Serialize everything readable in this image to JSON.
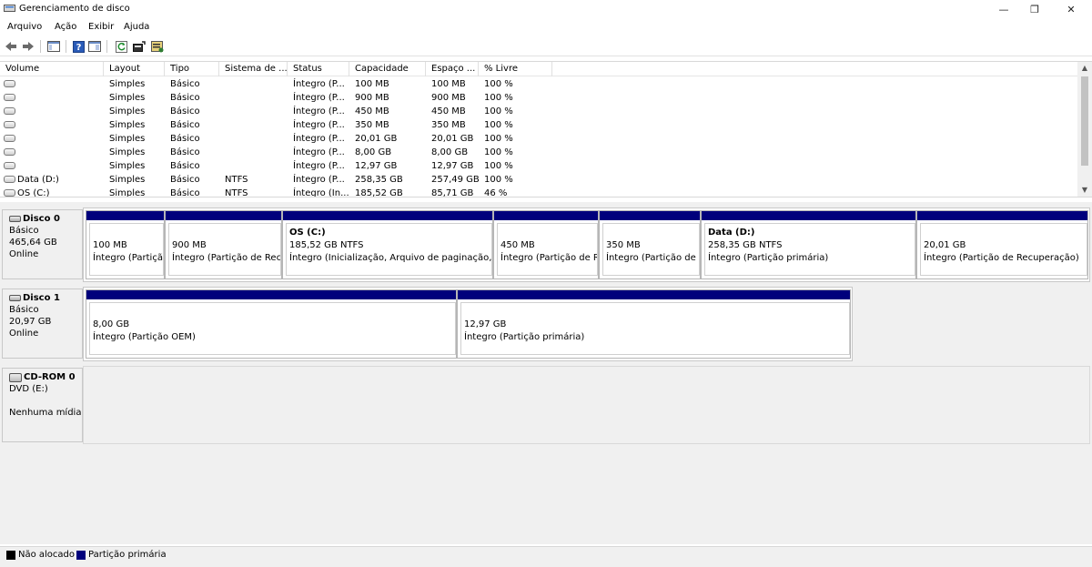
{
  "window": {
    "title": "Gerenciamento de disco",
    "minimize": "—",
    "maximize": "❐",
    "close": "✕"
  },
  "menu": [
    "Arquivo",
    "Ação",
    "Exibir",
    "Ajuda"
  ],
  "list": {
    "columns": [
      "Volume",
      "Layout",
      "Tipo",
      "Sistema de ...",
      "Status",
      "Capacidade",
      "Espaço ...",
      "% Livre"
    ],
    "rows": [
      {
        "volume": "",
        "layout": "Simples",
        "tipo": "Básico",
        "fs": "",
        "status": "Íntegro (P...",
        "cap": "100 MB",
        "free": "100 MB",
        "pct": "100 %"
      },
      {
        "volume": "",
        "layout": "Simples",
        "tipo": "Básico",
        "fs": "",
        "status": "Íntegro (P...",
        "cap": "900 MB",
        "free": "900 MB",
        "pct": "100 %"
      },
      {
        "volume": "",
        "layout": "Simples",
        "tipo": "Básico",
        "fs": "",
        "status": "Íntegro (P...",
        "cap": "450 MB",
        "free": "450 MB",
        "pct": "100 %"
      },
      {
        "volume": "",
        "layout": "Simples",
        "tipo": "Básico",
        "fs": "",
        "status": "Íntegro (P...",
        "cap": "350 MB",
        "free": "350 MB",
        "pct": "100 %"
      },
      {
        "volume": "",
        "layout": "Simples",
        "tipo": "Básico",
        "fs": "",
        "status": "Íntegro (P...",
        "cap": "20,01 GB",
        "free": "20,01 GB",
        "pct": "100 %"
      },
      {
        "volume": "",
        "layout": "Simples",
        "tipo": "Básico",
        "fs": "",
        "status": "Íntegro (P...",
        "cap": "8,00 GB",
        "free": "8,00 GB",
        "pct": "100 %"
      },
      {
        "volume": "",
        "layout": "Simples",
        "tipo": "Básico",
        "fs": "",
        "status": "Íntegro (P...",
        "cap": "12,97 GB",
        "free": "12,97 GB",
        "pct": "100 %"
      },
      {
        "volume": "Data (D:)",
        "layout": "Simples",
        "tipo": "Básico",
        "fs": "NTFS",
        "status": "Íntegro (P...",
        "cap": "258,35 GB",
        "free": "257,49 GB",
        "pct": "100 %"
      },
      {
        "volume": "OS (C:)",
        "layout": "Simples",
        "tipo": "Básico",
        "fs": "NTFS",
        "status": "Íntegro (In...",
        "cap": "185,52 GB",
        "free": "85,71 GB",
        "pct": "46 %"
      }
    ]
  },
  "disks": [
    {
      "name": "Disco 0",
      "type": "Básico",
      "size": "465,64 GB",
      "state": "Online",
      "partitions": [
        {
          "name": "",
          "size": "100 MB",
          "status": "Íntegro (Partição do Sistema EFI)"
        },
        {
          "name": "",
          "size": "900 MB",
          "status": "Íntegro (Partição de Recuperação)"
        },
        {
          "name": "OS  (C:)",
          "size": "185,52 GB NTFS",
          "status": "Íntegro (Inicialização, Arquivo de paginação, Despejo de Memória, Partição primária)"
        },
        {
          "name": "",
          "size": "450 MB",
          "status": "Íntegro (Partição de Recuperação)"
        },
        {
          "name": "",
          "size": "350 MB",
          "status": "Íntegro (Partição de Recuperação)"
        },
        {
          "name": "Data  (D:)",
          "size": "258,35 GB NTFS",
          "status": "Íntegro (Partição primária)"
        },
        {
          "name": "",
          "size": "20,01 GB",
          "status": "Íntegro (Partição de Recuperação)"
        }
      ]
    },
    {
      "name": "Disco 1",
      "type": "Básico",
      "size": "20,97 GB",
      "state": "Online",
      "partitions": [
        {
          "name": "",
          "size": "8,00 GB",
          "status": "Íntegro (Partição OEM)"
        },
        {
          "name": "",
          "size": "12,97 GB",
          "status": "Íntegro (Partição primária)"
        }
      ]
    },
    {
      "name": "CD-ROM 0",
      "type": "DVD (E:)",
      "media": "Nenhuma mídia"
    }
  ],
  "legend": [
    {
      "label": "Não alocado",
      "color": "#000000"
    },
    {
      "label": "Partição primária",
      "color": "#00007c"
    }
  ],
  "colors": {
    "partition_bar": "#00007c",
    "unallocated": "#000000"
  }
}
